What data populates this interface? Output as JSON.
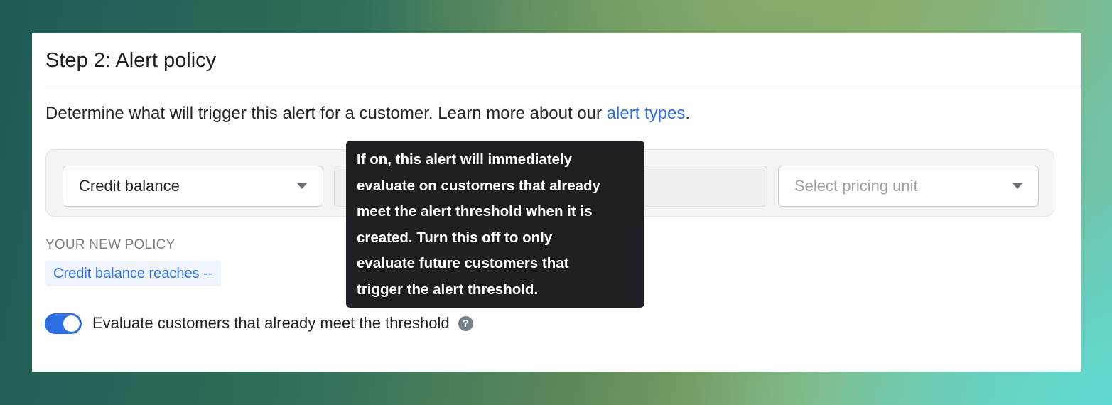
{
  "section": {
    "title": "Step 2: Alert policy",
    "description_prefix": "Determine what will trigger this alert for a customer. Learn more about our ",
    "description_link": "alert types",
    "description_suffix": "."
  },
  "policy_builder": {
    "alert_type_select": {
      "value": "Credit balance"
    },
    "pricing_unit_select": {
      "placeholder": "Select pricing unit"
    }
  },
  "policy_summary": {
    "label": "YOUR NEW POLICY",
    "chip": "Credit balance reaches --"
  },
  "evaluate_option": {
    "label": "Evaluate customers that already meet the threshold",
    "enabled": true,
    "help_icon": "question-mark-icon",
    "help_glyph": "?"
  },
  "tooltip": {
    "lines": [
      "If on, this alert will immediately",
      "evaluate on customers that already",
      "meet the alert threshold when it is",
      "created. Turn this off to only",
      "evaluate future customers that",
      "trigger the alert threshold."
    ]
  },
  "colors": {
    "accent": "#2f6fe4",
    "tooltip_bg": "#1e1f22",
    "panel_bg": "#f3f4f6"
  }
}
